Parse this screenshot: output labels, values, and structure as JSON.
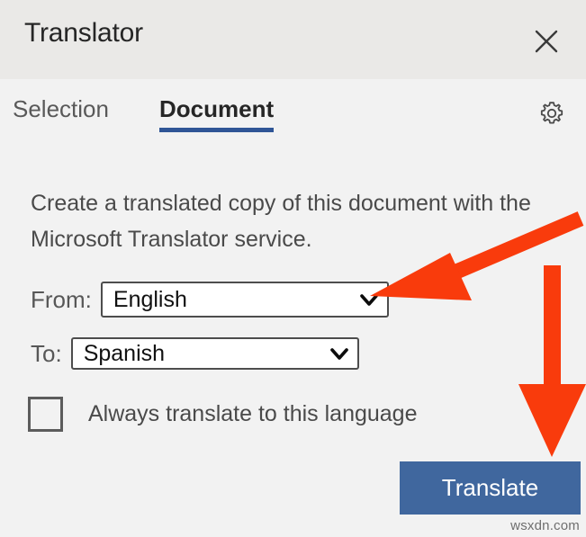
{
  "header": {
    "title": "Translator",
    "close_icon": "close-icon"
  },
  "tabs": {
    "items": [
      {
        "label": "Selection",
        "active": false
      },
      {
        "label": "Document",
        "active": true
      }
    ],
    "settings_icon": "gear-icon"
  },
  "main": {
    "description": "Create a translated copy of this document with the Microsoft Translator service.",
    "from": {
      "label": "From:",
      "value": "English",
      "chevron_icon": "chevron-down-icon"
    },
    "to": {
      "label": "To:",
      "value": "Spanish",
      "chevron_icon": "chevron-down-icon"
    },
    "always_translate": {
      "label": "Always translate to this language",
      "checked": false
    },
    "translate_button": "Translate"
  },
  "watermark": "wsxdn.com",
  "colors": {
    "header_background": "#eae9e7",
    "body_background": "#f2f2f2",
    "tab_accent": "#2f5596",
    "button_blue": "#40679e",
    "annotation_red": "#f93b0c",
    "text_primary": "#262626",
    "text_secondary": "#4a4a4a"
  },
  "annotations": {
    "arrow_to_from_dropdown": "red-arrow-diagonal",
    "arrow_to_translate_button": "red-arrow-down"
  }
}
